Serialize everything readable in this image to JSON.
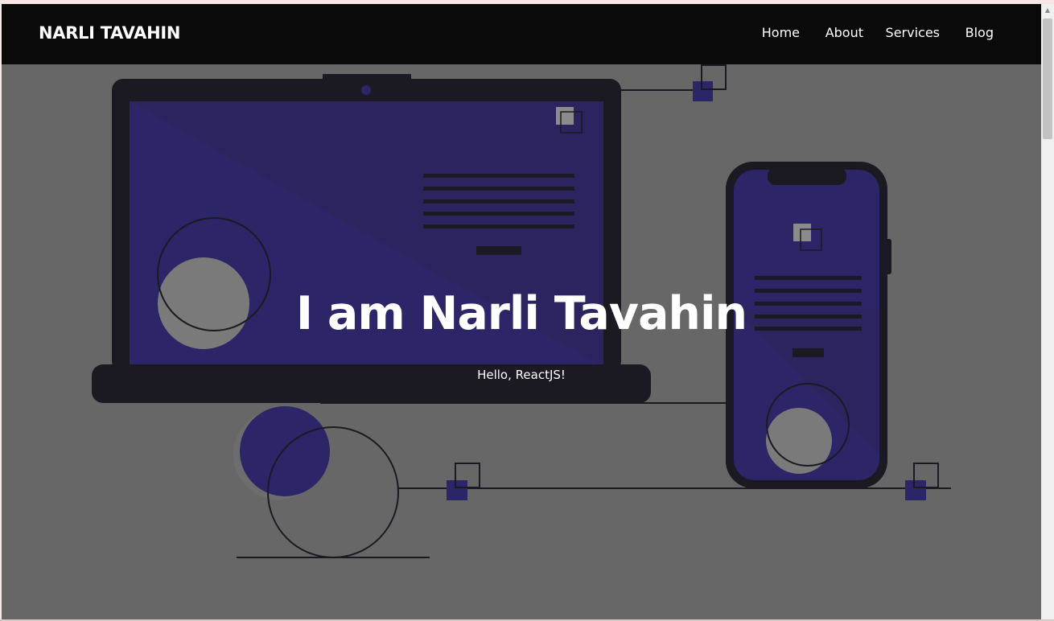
{
  "navbar": {
    "brand": "NARLI TAVAHIN",
    "links": [
      {
        "label": "Home"
      },
      {
        "label": "About"
      },
      {
        "label": "Services"
      },
      {
        "label": "Blog"
      }
    ]
  },
  "hero": {
    "title": "I am Narli Tavahin",
    "subtitle": "Hello, ReactJS!",
    "illustration": "laptop-and-phone-illustration"
  },
  "colors": {
    "navbar_bg": "#0a0a0a",
    "hero_bg": "#676767",
    "accent": "#2c2567",
    "device_frame": "#1b1921"
  }
}
